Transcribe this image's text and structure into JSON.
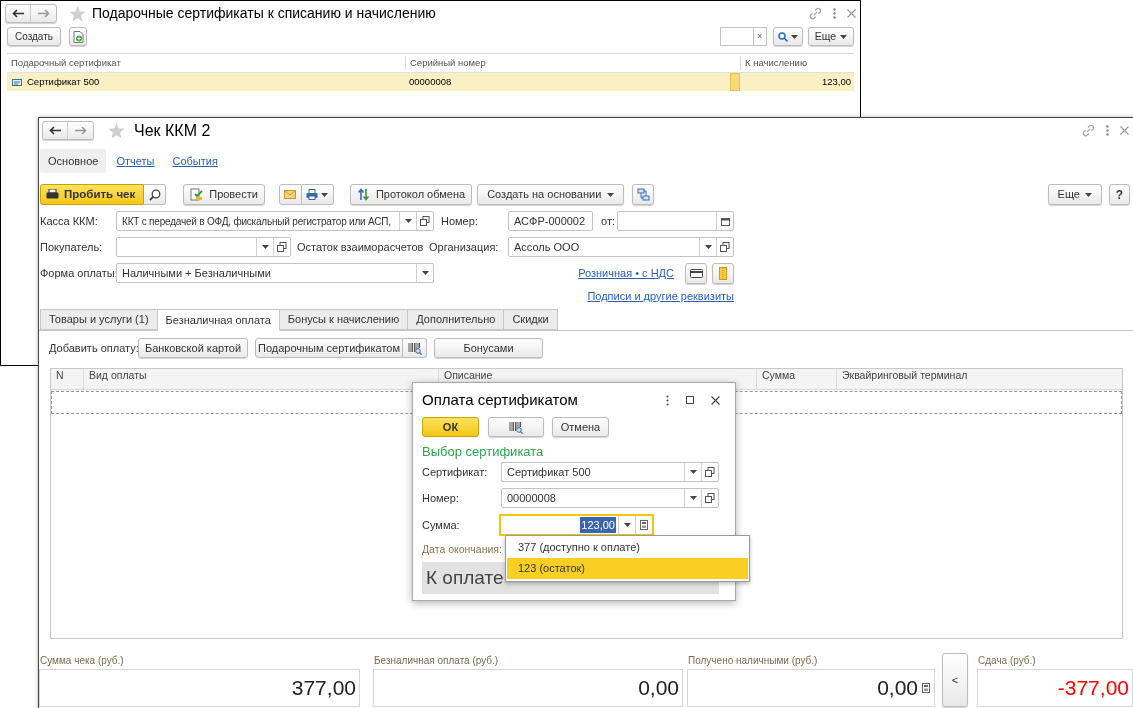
{
  "back_window": {
    "title": "Подарочные сертификаты к списанию и начислению",
    "toolbar": {
      "create": "Создать",
      "search_clear": "×",
      "more": "Еще"
    },
    "table": {
      "columns": [
        "Подарочный сертификат",
        "Серийный номер",
        "К начислению"
      ],
      "rows": [
        {
          "cells": [
            "Сертификат 500",
            "00000008",
            "123,00"
          ],
          "selected": true
        }
      ]
    }
  },
  "main_window": {
    "title": "Чек ККМ 2",
    "nav": [
      {
        "label": "Основное",
        "selected": true
      },
      {
        "label": "Отчеты",
        "selected": false
      },
      {
        "label": "События",
        "selected": false
      }
    ],
    "toolbar": {
      "punch": "Пробить чек",
      "post": "Провести",
      "exchange": "Протокол обмена",
      "create_based": "Создать на основании",
      "more": "Еще",
      "help": "?"
    },
    "cash_register": {
      "label": "Касса ККМ:",
      "value": "ККТ с передачей в ОФД, фискальный регистратор или АСП,"
    },
    "number": {
      "label": "Номер:",
      "value": "АСФР-000002"
    },
    "date": {
      "label": "от:"
    },
    "buyer": {
      "label": "Покупатель:"
    },
    "settlement_balance": "Остаток взаиморасчетов",
    "organization": {
      "label": "Организация:",
      "value": "Ассоль ООО"
    },
    "payment_form": {
      "label": "Форма оплаты:",
      "value": "Наличными + Безналичными"
    },
    "price_type_link": "Розничная • с НДС",
    "signatures_link": "Подписи и другие реквизиты",
    "tabs": [
      {
        "label": "Товары и услуги (1)",
        "selected": false
      },
      {
        "label": "Безналичная оплата",
        "selected": true
      },
      {
        "label": "Бонусы к начислению",
        "selected": false
      },
      {
        "label": "Дополнительно",
        "selected": false
      },
      {
        "label": "Скидки",
        "selected": false
      }
    ],
    "add_payment": {
      "label": "Добавить оплату:",
      "card": "Банковской картой",
      "certificate": "Подарочным сертификатом",
      "bonuses": "Бонусами"
    },
    "table": {
      "columns": [
        "N",
        "Вид оплаты",
        "Описание",
        "Сумма",
        "Эквайринговый терминал"
      ]
    },
    "totals": [
      {
        "label": "Сумма чека (руб.)",
        "value": "377,00",
        "negative": false
      },
      {
        "label": "Безналичная оплата (руб.)",
        "value": "0,00",
        "negative": false
      },
      {
        "label": "Получено наличными (руб.)",
        "value": "0,00",
        "negative": false
      },
      {
        "label": "Сдача (руб.)",
        "value": "-377,00",
        "negative": true
      }
    ],
    "change_button": "<"
  },
  "dialog": {
    "title": "Оплата сертификатом",
    "ok": "ОК",
    "cancel": "Отмена",
    "section": "Выбор сертификата",
    "certificate": {
      "label": "Сертификат:",
      "value": "Сертификат 500"
    },
    "number": {
      "label": "Номер:",
      "value": "00000008"
    },
    "amount": {
      "label": "Сумма:",
      "value": "123,00"
    },
    "end_date": {
      "label": "Дата окончания:"
    },
    "to_pay": "К оплате",
    "suggestions": [
      {
        "label": "377 (доступно к оплате)",
        "selected": false
      },
      {
        "label": "123 (остаток)",
        "selected": true
      }
    ]
  }
}
